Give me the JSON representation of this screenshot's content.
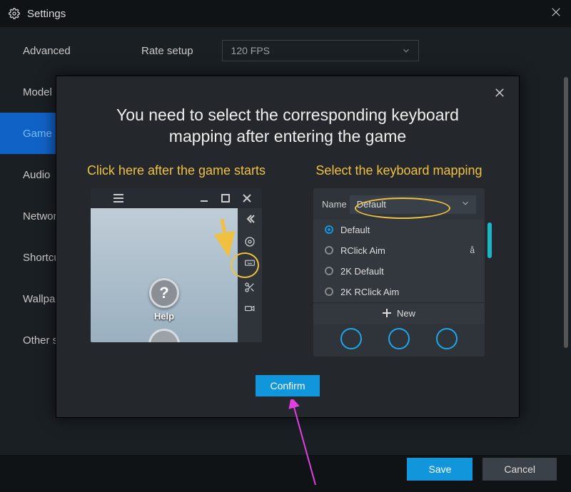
{
  "window": {
    "title": "Settings"
  },
  "sidebar": {
    "items": [
      {
        "label": "Advanced"
      },
      {
        "label": "Model"
      },
      {
        "label": "Game"
      },
      {
        "label": "Audio"
      },
      {
        "label": "Network"
      },
      {
        "label": "Shortcuts"
      },
      {
        "label": "Wallpaper"
      },
      {
        "label": "Other settings"
      }
    ]
  },
  "main": {
    "rate_label": "Rate setup",
    "rate_value": "120 FPS"
  },
  "footer": {
    "save": "Save",
    "cancel": "Cancel"
  },
  "modal": {
    "title": "You need to select the corresponding keyboard mapping after entering the game",
    "left_heading": "Click here after the game starts",
    "right_heading": "Select the keyboard mapping",
    "help_label": "Help",
    "name_label": "Name",
    "name_value": "Default",
    "options": [
      {
        "label": "Default",
        "selected": true
      },
      {
        "label": "RClick Aim",
        "selected": false,
        "pinned": true
      },
      {
        "label": "2K Default",
        "selected": false
      },
      {
        "label": "2K RClick Aim",
        "selected": false
      }
    ],
    "new_label": "New",
    "confirm": "Confirm"
  }
}
